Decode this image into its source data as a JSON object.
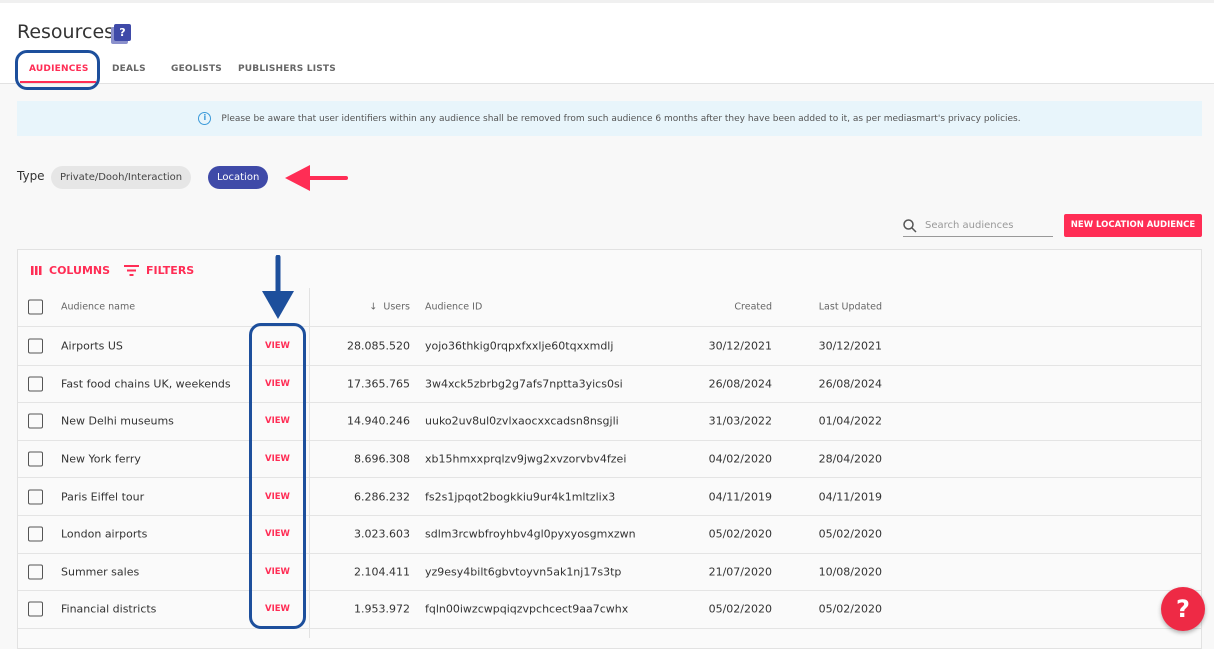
{
  "header": {
    "title": "Resources",
    "help_icon": "?"
  },
  "tabs": [
    {
      "label": "AUDIENCES"
    },
    {
      "label": "DEALS"
    },
    {
      "label": "GEOLISTS"
    },
    {
      "label": "PUBLISHERS LISTS"
    }
  ],
  "notice": "Please be aware that user identifiers within any audience shall be removed from such audience 6 months after they have been added to it, as per mediasmart's privacy policies.",
  "type_filter": {
    "label": "Type",
    "options": [
      "Private/Dooh/Interaction",
      "Location"
    ],
    "selected": "Location"
  },
  "search": {
    "placeholder": "Search audiences"
  },
  "new_button": "NEW LOCATION AUDIENCE",
  "toolbar": {
    "columns": "COLUMNS",
    "filters": "FILTERS"
  },
  "columns": {
    "name": "Audience name",
    "users": "Users",
    "id": "Audience ID",
    "created": "Created",
    "updated": "Last Updated"
  },
  "rows": [
    {
      "name": "Airports US",
      "view": "VIEW",
      "users": "28.085.520",
      "id": "yojo36thkig0rqpxfxxlje60tqxxmdlj",
      "created": "30/12/2021",
      "updated": "30/12/2021"
    },
    {
      "name": "Fast food chains UK, weekends",
      "view": "VIEW",
      "users": "17.365.765",
      "id": "3w4xck5zbrbg2g7afs7nptta3yics0si",
      "created": "26/08/2024",
      "updated": "26/08/2024"
    },
    {
      "name": "New Delhi museums",
      "view": "VIEW",
      "users": "14.940.246",
      "id": "uuko2uv8ul0zvlxaocxxcadsn8nsgjli",
      "created": "31/03/2022",
      "updated": "01/04/2022"
    },
    {
      "name": "New York ferry",
      "view": "VIEW",
      "users": "8.696.308",
      "id": "xb15hmxxprqlzv9jwg2xvzorvbv4fzei",
      "created": "04/02/2020",
      "updated": "28/04/2020"
    },
    {
      "name": "Paris Eiffel tour",
      "view": "VIEW",
      "users": "6.286.232",
      "id": "fs2s1jpqot2bogkkiu9ur4k1mltzlix3",
      "created": "04/11/2019",
      "updated": "04/11/2019"
    },
    {
      "name": "London airports",
      "view": "VIEW",
      "users": "3.023.603",
      "id": "sdlm3rcwbfroyhbv4gl0pyxyosgmxzwn",
      "created": "05/02/2020",
      "updated": "05/02/2020"
    },
    {
      "name": "Summer sales",
      "view": "VIEW",
      "users": "2.104.411",
      "id": "yz9esy4bilt6gbvtoyvn5ak1nj17s3tp",
      "created": "21/07/2020",
      "updated": "10/08/2020"
    },
    {
      "name": "Financial districts",
      "view": "VIEW",
      "users": "1.953.972",
      "id": "fqln00iwzcwpqiqzvpchcect9aa7cwhx",
      "created": "05/02/2020",
      "updated": "05/02/2020"
    }
  ],
  "fab": "?"
}
